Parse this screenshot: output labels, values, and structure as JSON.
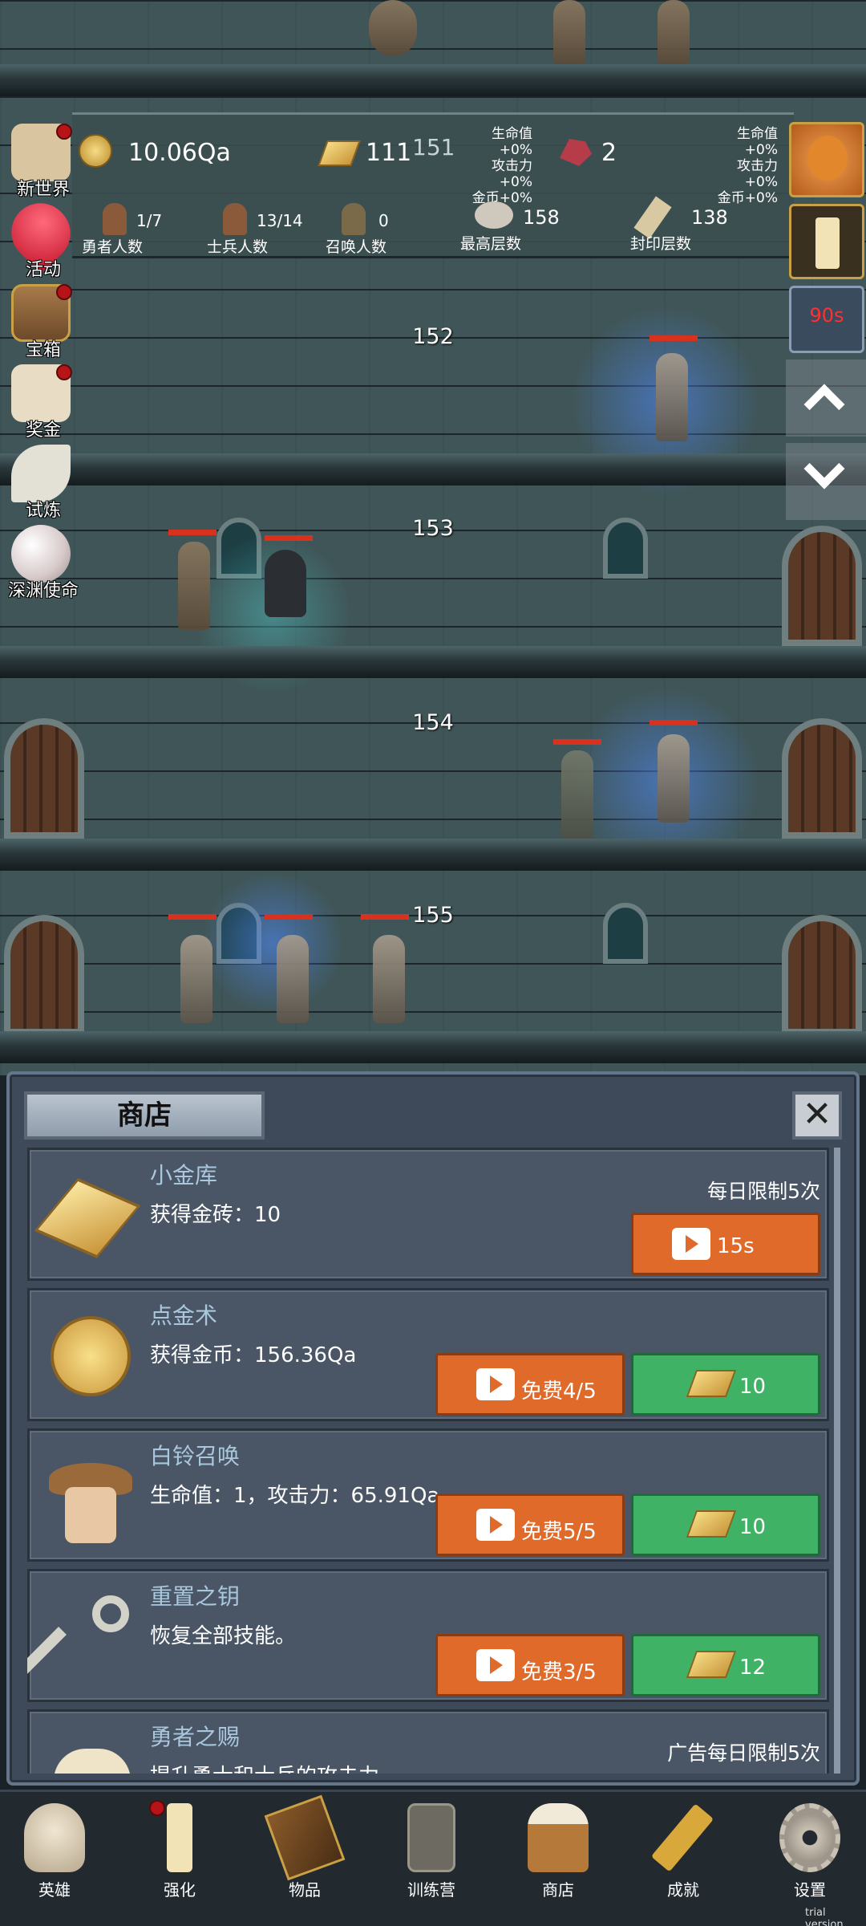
{
  "stats": {
    "gold": "10.06Qa",
    "gold_bar": "111",
    "floor_top": "151",
    "gem": "2",
    "buffs_left": [
      "生命值+0%",
      "攻击力+0%",
      "金币+0%"
    ],
    "buffs_right": [
      "生命值+0%",
      "攻击力+0%",
      "金币+0%"
    ],
    "heroes": {
      "value": "1/7",
      "label": "勇者人数"
    },
    "soldiers": {
      "value": "13/14",
      "label": "士兵人数"
    },
    "summons": {
      "value": "0",
      "label": "召唤人数"
    },
    "max_floor": {
      "value": "158",
      "label": "最高层数"
    },
    "sealed_floor": {
      "value": "138",
      "label": "封印层数"
    }
  },
  "floors": [
    "152",
    "153",
    "154",
    "155"
  ],
  "side_menu": [
    {
      "label": "新世界",
      "icon": "map-icon",
      "dot": true
    },
    {
      "label": "活动",
      "icon": "heart-icon",
      "dot": false
    },
    {
      "label": "宝箱",
      "icon": "chest-icon",
      "dot": true
    },
    {
      "label": "奖金",
      "icon": "envelope-icon",
      "dot": true
    },
    {
      "label": "试炼",
      "icon": "feather-icon",
      "dot": false
    },
    {
      "label": "深渊使命",
      "icon": "pearl-icon",
      "dot": false
    }
  ],
  "right_menu": {
    "timer": "90s"
  },
  "shop": {
    "tab": "商店",
    "close_icon": "close-icon",
    "items": [
      {
        "title": "小金库",
        "desc": "获得金砖：10",
        "limit": "每日限制5次",
        "ad": "15s",
        "price": "",
        "icon": "gold-bar-icon"
      },
      {
        "title": "点金术",
        "desc": "获得金币：156.36Qa",
        "limit": "",
        "ad": "免费4/5",
        "price": "10",
        "icon": "gold-coin-icon"
      },
      {
        "title": "白铃召唤",
        "desc": "生命值：1，攻击力：65.91Qa",
        "limit": "",
        "ad": "免费5/5",
        "price": "10",
        "icon": "girl-portrait-icon"
      },
      {
        "title": "重置之钥",
        "desc": "恢复全部技能。",
        "limit": "",
        "ad": "免费3/5",
        "price": "12",
        "icon": "key-icon"
      },
      {
        "title": "勇者之赐",
        "desc": "提升勇士和士兵的攻击力。",
        "limit": "广告每日限制5次",
        "ad": "",
        "price": "",
        "icon": "beer-mug-icon"
      }
    ]
  },
  "nav": [
    {
      "label": "英雄",
      "icon": "skull-icon"
    },
    {
      "label": "强化",
      "icon": "candle-icon"
    },
    {
      "label": "物品",
      "icon": "book-icon"
    },
    {
      "label": "训练营",
      "icon": "lantern-icon"
    },
    {
      "label": "商店",
      "icon": "beer-mug-icon"
    },
    {
      "label": "成就",
      "icon": "golden-key-icon"
    },
    {
      "label": "设置",
      "icon": "gear-icon"
    }
  ],
  "watermark": "trial version",
  "colors": {
    "accent_orange": "#e06a2a",
    "accent_green": "#3fb266",
    "hp_red": "#d8321f",
    "panel": "#3e4a59"
  }
}
